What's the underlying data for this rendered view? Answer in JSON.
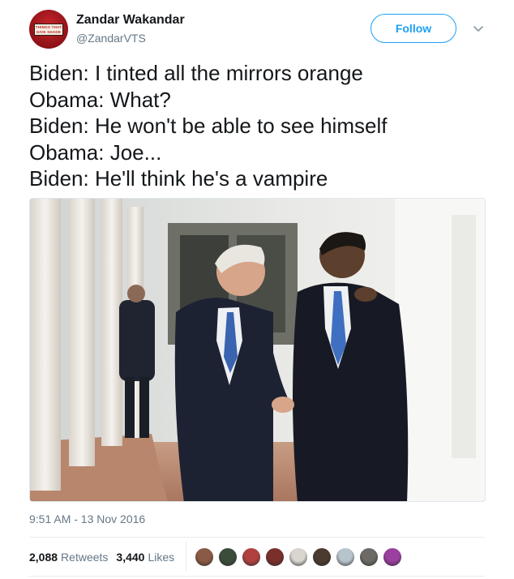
{
  "user": {
    "name": "Zandar Wakandar",
    "handle": "@ZandarVTS",
    "avatar_text": "THINGS THAT GIVE SHADE"
  },
  "follow_label": "Follow",
  "tweet_lines": [
    "Biden: I tinted all the mirrors orange",
    "Obama: What?",
    "Biden: He won't be able to see himself",
    "Obama: Joe...",
    "Biden: He'll think he's a vampire"
  ],
  "photo": {
    "subject": "Two men in dark suits walking down a white colonnade"
  },
  "timestamp": "9:51 AM - 13 Nov 2016",
  "stats": {
    "retweets_count": "2,088",
    "retweets_label": "Retweets",
    "likes_count": "3,440",
    "likes_label": "Likes"
  },
  "likers": [
    {
      "color": "#8a5a44"
    },
    {
      "color": "#3b4d3a"
    },
    {
      "color": "#b0413e"
    },
    {
      "color": "#7a2f2a"
    },
    {
      "color": "#d9d6cf"
    },
    {
      "color": "#4b3a2f"
    },
    {
      "color": "#b8c4cc"
    },
    {
      "color": "#6d6a66"
    },
    {
      "color": "#9b3fa0"
    }
  ],
  "icons": {
    "caret": "chevron-down-icon"
  }
}
